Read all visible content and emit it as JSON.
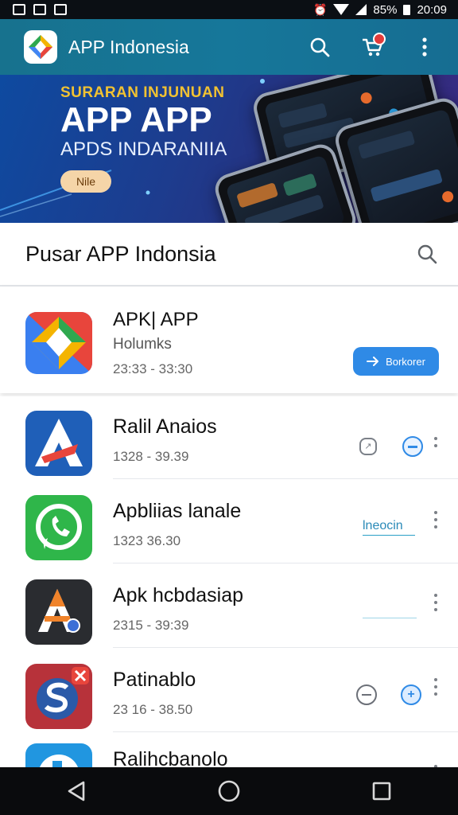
{
  "statusbar": {
    "battery": "85%",
    "time": "20:09"
  },
  "appbar": {
    "title": "APP Indonesia"
  },
  "banner": {
    "subtitle": "SURARAN INJUNUAN",
    "title": "APP APP",
    "line": "APDS INDARANIIA",
    "pill": "Nile"
  },
  "section": {
    "title": "Pusar APP Indonsia"
  },
  "featured": {
    "name": "APK| APP",
    "subtitle": "Holumks",
    "meta": "23:33 - 33:30",
    "button": "Borkorer"
  },
  "list": [
    {
      "name": "Ralil Anaios",
      "meta": "1328 - 39.39"
    },
    {
      "name": "Apbliias lanale",
      "meta": "1323  36.30",
      "link": "lneocin"
    },
    {
      "name": "Apk hcbdasiap",
      "meta": "2315 - 39:39"
    },
    {
      "name": "Patinablo",
      "meta": "23 16 - 38.50"
    },
    {
      "name": "Ralihcbanolo",
      "meta": ""
    }
  ],
  "colors": {
    "accent": "#2f8ae6",
    "appbar": "#17728e"
  }
}
